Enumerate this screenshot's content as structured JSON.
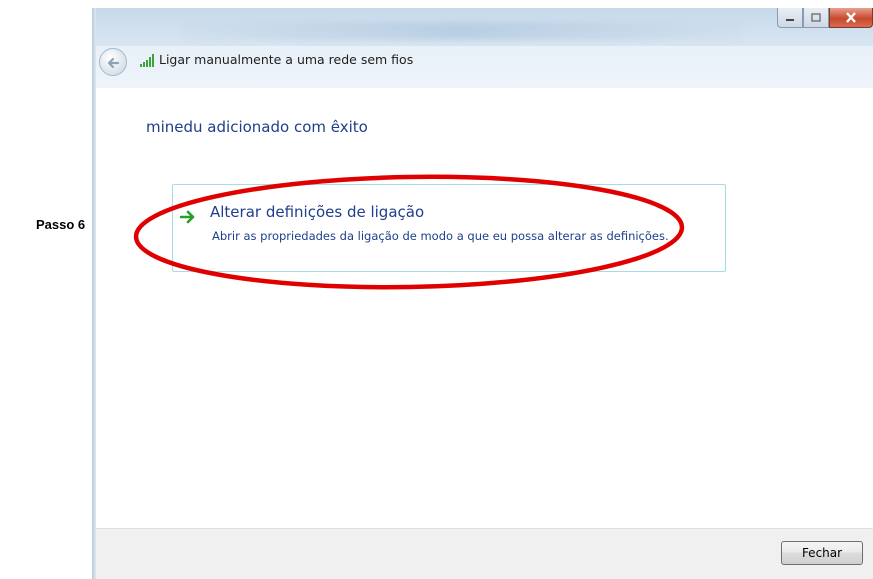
{
  "annotation": {
    "step_label": "Passo 6"
  },
  "window": {
    "title": "Ligar manualmente a uma rede sem fios",
    "controls": {
      "minimize_icon": "minimize-icon",
      "maximize_icon": "maximize-icon",
      "close_icon": "close-icon"
    }
  },
  "content": {
    "heading": "minedu adicionado com êxito",
    "option": {
      "title": "Alterar definições de ligação",
      "description": "Abrir as propriedades da ligação de modo a que eu possa alterar as definições.",
      "arrow_color": "#2a9d2a"
    }
  },
  "footer": {
    "close_label": "Fechar"
  },
  "colors": {
    "link_blue": "#1e3f8b",
    "highlight_red": "#e00000",
    "option_border": "#a6dde5"
  }
}
